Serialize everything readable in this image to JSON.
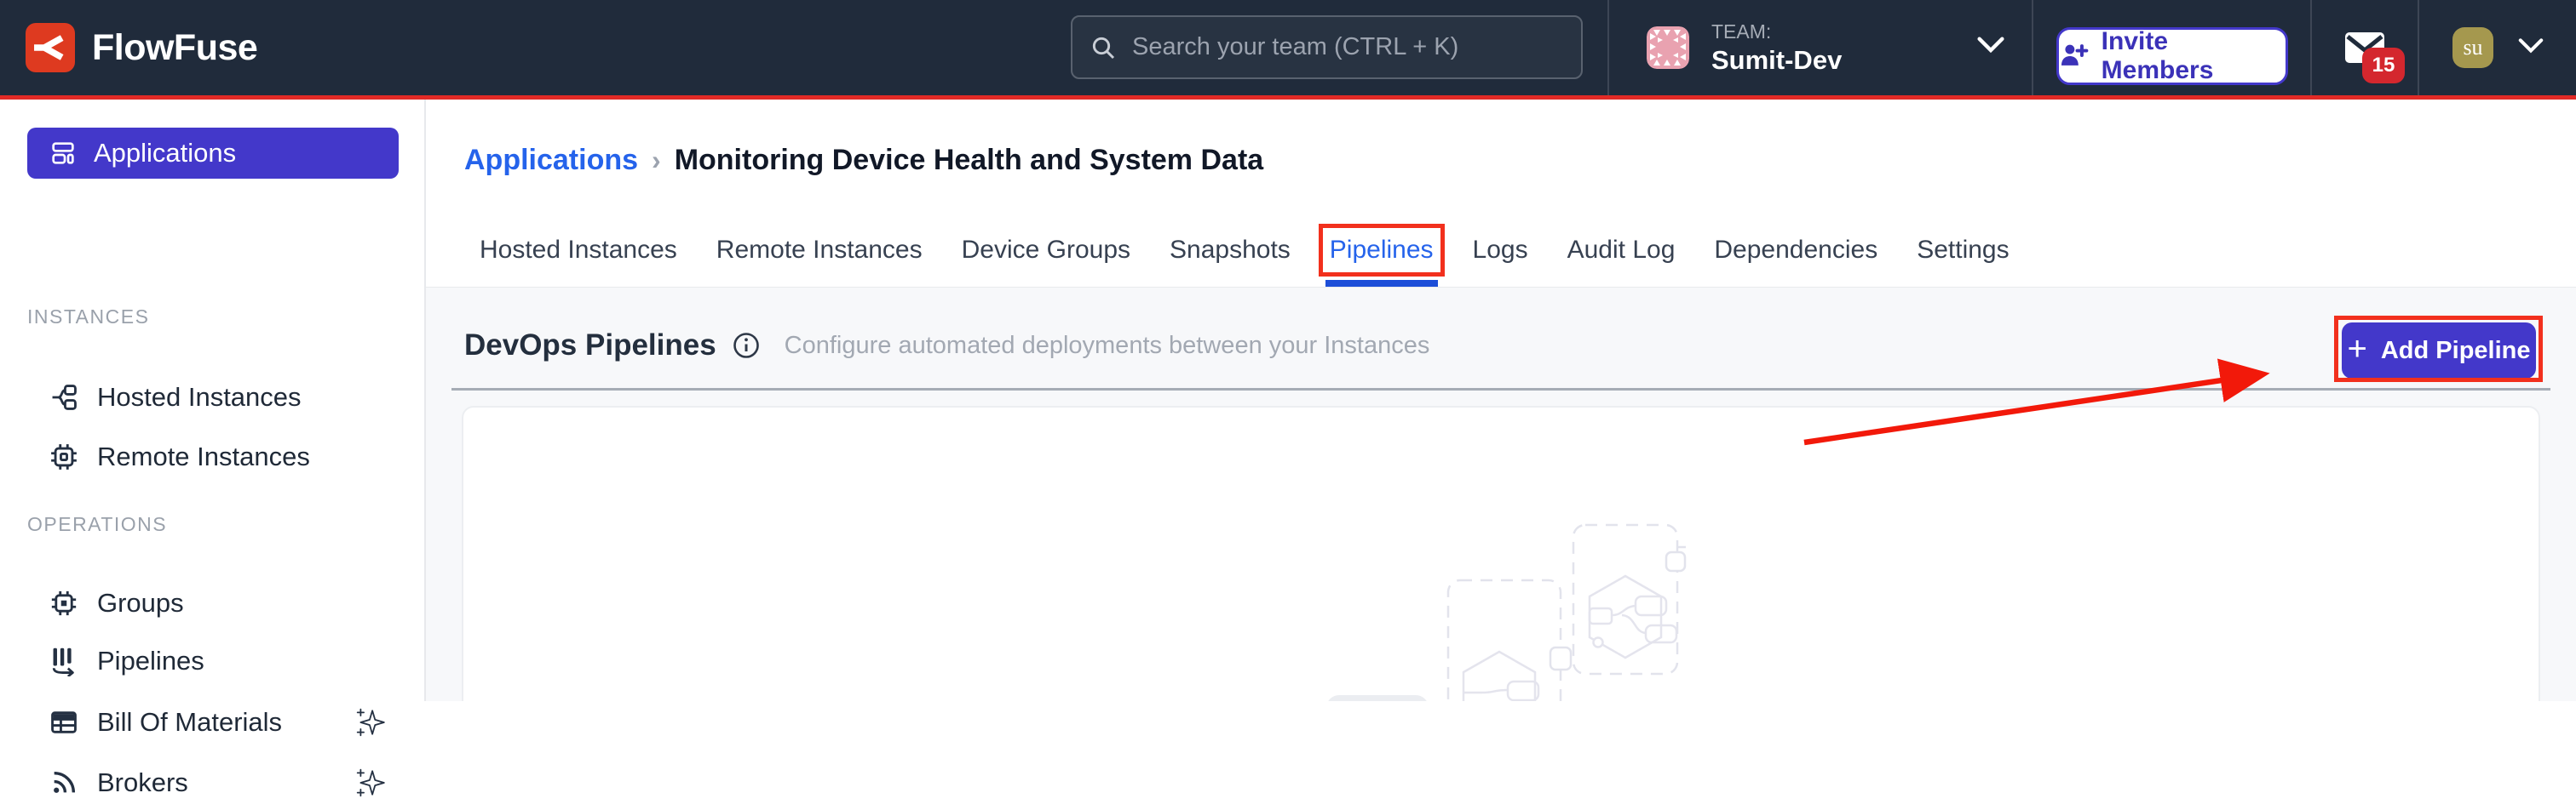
{
  "navbar": {
    "brand": "FlowFuse",
    "search": {
      "placeholder": "Search your team (CTRL + K)"
    },
    "team": {
      "label": "TEAM:",
      "name": "Sumit-Dev"
    },
    "invite_label": "Invite Members",
    "notification_count": "15",
    "user_initials": "su"
  },
  "sidebar": {
    "primary_label": "Applications",
    "sections": [
      {
        "title": "INSTANCES",
        "items": [
          {
            "label": "Hosted Instances"
          },
          {
            "label": "Remote Instances"
          }
        ]
      },
      {
        "title": "OPERATIONS",
        "items": [
          {
            "label": "Groups"
          },
          {
            "label": "Pipelines"
          },
          {
            "label": "Bill Of Materials"
          },
          {
            "label": "Brokers"
          }
        ]
      }
    ]
  },
  "breadcrumb": {
    "parent": "Applications",
    "separator": "›",
    "current": "Monitoring Device Health and System Data"
  },
  "tabs": {
    "items": [
      "Hosted Instances",
      "Remote Instances",
      "Device Groups",
      "Snapshots",
      "Pipelines",
      "Logs",
      "Audit Log",
      "Dependencies",
      "Settings"
    ],
    "active": "Pipelines"
  },
  "pipelines": {
    "title": "DevOps Pipelines",
    "subtitle": "Configure automated deployments between your Instances",
    "add_plus": "+",
    "add_label": "Add Pipeline"
  },
  "colors": {
    "navbar_bg": "#202B3B",
    "brand_red": "#DE3A20",
    "accent_red_line": "#E22A26",
    "primary_indigo": "#4338CA",
    "link_blue": "#2563EB",
    "active_tab_underline": "#1D4ED8",
    "notification_badge": "#D4272E",
    "user_avatar_bg": "#A5984E",
    "team_avatar_pink": "#E9A2B0",
    "annotation_red": "#F2301D",
    "section_bg": "#F7F8FA"
  }
}
